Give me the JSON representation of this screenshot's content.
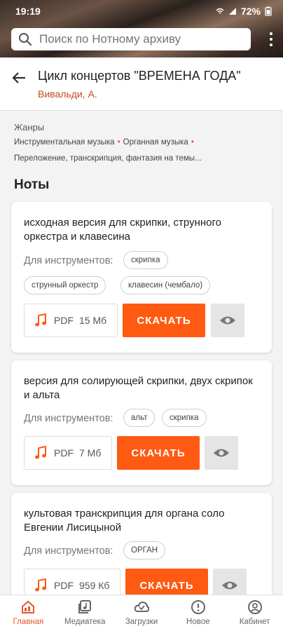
{
  "status": {
    "time": "19:19",
    "battery": "72%"
  },
  "search": {
    "placeholder": "Поиск по Нотному архиву"
  },
  "header": {
    "title": "Цикл концертов \"ВРЕМЕНА ГОДА\"",
    "composer": "Вивальди, А."
  },
  "genres": {
    "label": "Жанры",
    "items": [
      "Инструментальная музыка",
      "Органная музыка",
      "Переложение, транскрипция, фантазия на темы..."
    ]
  },
  "notes_heading": "Ноты",
  "cards": [
    {
      "title": "исходная версия для скрипки, струнного оркестра и клавесина",
      "instruments_label": "Для инструментов:",
      "instruments": [
        "скрипка",
        "струнный оркестр",
        "клавесин (чембало)"
      ],
      "file_type": "PDF",
      "file_size": "15 Мб",
      "download_label": "СКАЧАТЬ"
    },
    {
      "title": "версия для солирующей скрипки, двух скрипок и альта",
      "instruments_label": "Для инструментов:",
      "instruments": [
        "альт",
        "скрипка"
      ],
      "file_type": "PDF",
      "file_size": "7 Мб",
      "download_label": "СКАЧАТЬ"
    },
    {
      "title": "культовая транскрипция для органа соло Евгении Лисицыной",
      "instruments_label": "Для инструментов:",
      "instruments": [
        "ОРГАН"
      ],
      "file_type": "PDF",
      "file_size": "959 Кб",
      "download_label": "СКАЧАТЬ"
    }
  ],
  "nav": [
    {
      "label": "Главная",
      "icon": "home-icon",
      "active": true
    },
    {
      "label": "Медиатека",
      "icon": "media-library-icon"
    },
    {
      "label": "Загрузки",
      "icon": "cloud-download-icon"
    },
    {
      "label": "Новое",
      "icon": "new-alert-icon"
    },
    {
      "label": "Кабинет",
      "icon": "account-icon"
    }
  ],
  "colors": {
    "accent": "#ff5a12",
    "composer": "#c34a22",
    "active_nav": "#e8572a"
  }
}
